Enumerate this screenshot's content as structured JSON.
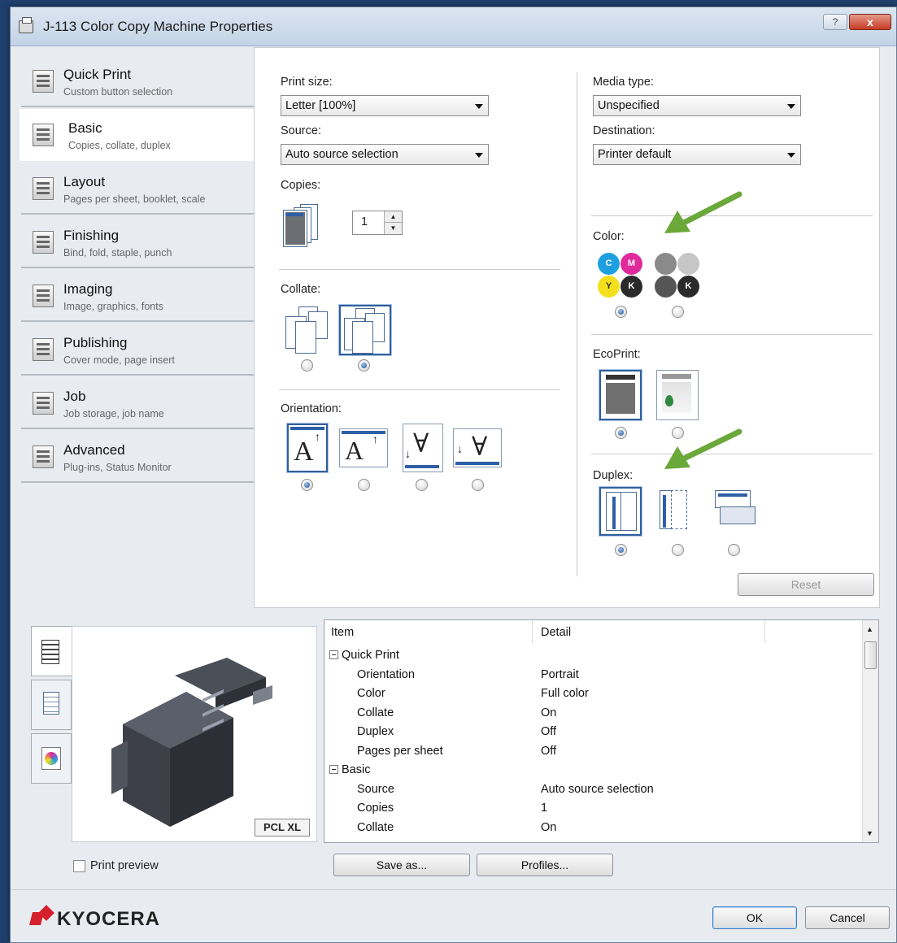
{
  "window": {
    "title": "J-113 Color Copy Machine Properties",
    "help": "?",
    "close": "x"
  },
  "nav": [
    {
      "name": "Quick Print",
      "desc": "Custom button selection"
    },
    {
      "name": "Basic",
      "desc": "Copies, collate, duplex"
    },
    {
      "name": "Layout",
      "desc": "Pages per sheet, booklet, scale"
    },
    {
      "name": "Finishing",
      "desc": "Bind, fold, staple, punch"
    },
    {
      "name": "Imaging",
      "desc": "Image, graphics, fonts"
    },
    {
      "name": "Publishing",
      "desc": "Cover mode, page insert"
    },
    {
      "name": "Job",
      "desc": "Job storage, job name"
    },
    {
      "name": "Advanced",
      "desc": "Plug-ins, Status Monitor"
    }
  ],
  "basic": {
    "print_size_label": "Print size:",
    "print_size_value": "Letter  [100%]",
    "source_label": "Source:",
    "source_value": "Auto source selection",
    "copies_label": "Copies:",
    "copies_value": "1",
    "collate_label": "Collate:",
    "orientation_label": "Orientation:",
    "media_type_label": "Media type:",
    "media_type_value": "Unspecified",
    "destination_label": "Destination:",
    "destination_value": "Printer default",
    "color_label": "Color:",
    "ecoprint_label": "EcoPrint:",
    "duplex_label": "Duplex:",
    "reset": "Reset",
    "ink": {
      "c": "C",
      "m": "M",
      "y": "Y",
      "k": "K"
    }
  },
  "preview": {
    "pdl": "PCL XL",
    "print_preview": "Print preview"
  },
  "grid": {
    "headers": {
      "item": "Item",
      "detail": "Detail"
    },
    "rows": [
      {
        "group": true,
        "item": "Quick Print",
        "detail": ""
      },
      {
        "group": false,
        "item": "Orientation",
        "detail": "Portrait"
      },
      {
        "group": false,
        "item": "Color",
        "detail": "Full color"
      },
      {
        "group": false,
        "item": "Collate",
        "detail": "On"
      },
      {
        "group": false,
        "item": "Duplex",
        "detail": "Off"
      },
      {
        "group": false,
        "item": "Pages per sheet",
        "detail": "Off"
      },
      {
        "group": true,
        "item": "Basic",
        "detail": ""
      },
      {
        "group": false,
        "item": "Source",
        "detail": "Auto source selection"
      },
      {
        "group": false,
        "item": "Copies",
        "detail": "1"
      },
      {
        "group": false,
        "item": "Collate",
        "detail": "On"
      }
    ]
  },
  "buttons": {
    "save_as": "Save as...",
    "profiles": "Profiles...",
    "ok": "OK",
    "cancel": "Cancel"
  },
  "brand": {
    "logo": "KYOCERA",
    "color": "#d4202a"
  },
  "colors": {
    "accent": "#2e5fa6",
    "annotation_arrow": "#6aa83a"
  }
}
